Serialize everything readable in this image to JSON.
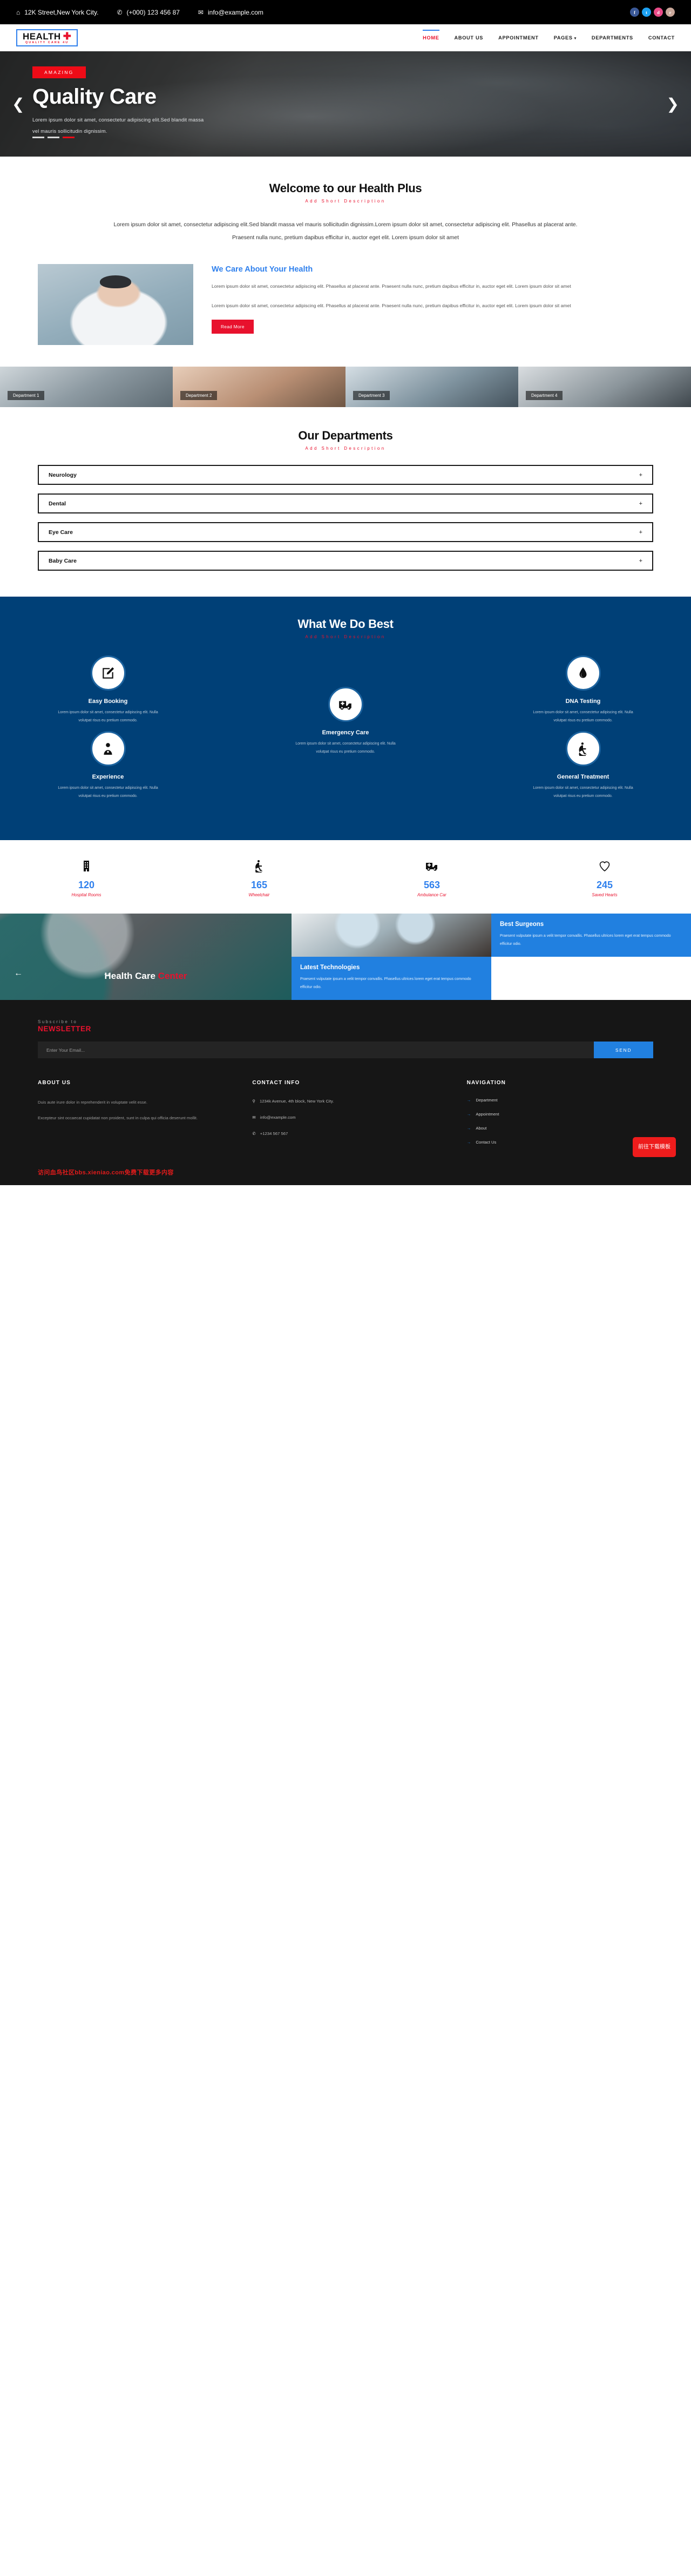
{
  "topbar": {
    "address": "12K Street,New York City.",
    "phone": "(+000) 123 456 87",
    "email": "info@example.com",
    "social": [
      "f",
      "t",
      "d",
      "r"
    ]
  },
  "logo": {
    "line1": "HEALTH",
    "cross": "✚",
    "line2": "QUALITY CARE 4U"
  },
  "nav": {
    "items": [
      {
        "label": "HOME",
        "active": true
      },
      {
        "label": "ABOUT US",
        "active": false
      },
      {
        "label": "APPOINTMENT",
        "active": false
      },
      {
        "label": "PAGES",
        "active": false,
        "caret": "▾"
      },
      {
        "label": "DEPARTMENTS",
        "active": false
      },
      {
        "label": "CONTACT",
        "active": false
      }
    ]
  },
  "hero": {
    "badge": "AMAZING",
    "title": "Quality Care",
    "text": "Lorem ipsum dolor sit amet, consectetur adipiscing elit.Sed blandit massa vel mauris sollicitudin dignissim.",
    "prev": "❮",
    "next": "❯"
  },
  "welcome": {
    "title": "Welcome to our Health Plus",
    "subtitle": "Add Short Description",
    "body": "Lorem ipsum dolor sit amet, consectetur adipiscing elit.Sed blandit massa vel mauris sollicitudin dignissim.Lorem ipsum dolor sit amet, consectetur adipiscing elit. Phasellus at placerat ante. Praesent nulla nunc, pretium dapibus efficitur in, auctor eget elit. Lorem ipsum dolor sit amet"
  },
  "care": {
    "heading": "We Care About Your Health",
    "p1": "Lorem ipsum dolor sit amet, consectetur adipiscing elit. Phasellus at placerat ante. Praesent nulla nunc, pretium dapibus efficitur in, auctor eget elit. Lorem ipsum dolor sit amet",
    "p2": "Lorem ipsum dolor sit amet, consectetur adipiscing elit. Phasellus at placerat ante. Praesent nulla nunc, pretium dapibus efficitur in, auctor eget elit. Lorem ipsum dolor sit amet",
    "button": "Read More"
  },
  "dept_strip": [
    {
      "label": "Department 1"
    },
    {
      "label": "Department 2"
    },
    {
      "label": "Department 3"
    },
    {
      "label": "Department 4"
    }
  ],
  "departments": {
    "title": "Our Departments",
    "subtitle": "Add Short Description",
    "items": [
      {
        "name": "Neurology",
        "toggle": "+"
      },
      {
        "name": "Dental",
        "toggle": "+"
      },
      {
        "name": "Eye Care",
        "toggle": "+"
      },
      {
        "name": "Baby Care",
        "toggle": "+"
      }
    ]
  },
  "best": {
    "title": "What We Do Best",
    "subtitle": "Add Short Description",
    "desc": "Lorem ipsum dolor sit amet, consectetur adipiscing elit. Nulla volutpat risus eu pretium commodo.",
    "items": [
      {
        "title": "Easy Booking",
        "icon": "pencil-square-icon"
      },
      {
        "title": "Emergency Care",
        "icon": "ambulance-icon"
      },
      {
        "title": "DNA Testing",
        "icon": "blood-drop-icon"
      },
      {
        "title": "Experience",
        "icon": "doctor-icon"
      },
      {
        "title": "General Treatment",
        "icon": "wheelchair-icon"
      }
    ]
  },
  "counters": [
    {
      "value": "120",
      "label": "Hospital Rooms",
      "icon": "hospital-building-icon"
    },
    {
      "value": "165",
      "label": "Wheelchair",
      "icon": "wheelchair-icon"
    },
    {
      "value": "563",
      "label": "Ambulance Car",
      "icon": "ambulance-icon"
    },
    {
      "value": "245",
      "label": "Saved Hearts",
      "icon": "heart-icon"
    }
  ],
  "gallery": {
    "title_white": "Health Care ",
    "title_red": "Center",
    "prev": "←",
    "next": "→",
    "cards": [
      {
        "title": "Best Surgeons",
        "text": "Praesent vulputate ipsum a velit tempor convallis. Phasellus ultrices lorem eget erat tempus commodo efficitur odio."
      },
      {
        "title": "Latest Technologies",
        "text": "Praesent vulputate ipsum a velit tempor convallis. Phasellus ultrices lorem eget erat tempus commodo efficitur odio."
      }
    ]
  },
  "newsletter": {
    "small": "Subscribe to",
    "big": "NEWSLETTER",
    "placeholder": "Enter Your Email...",
    "button": "SEND"
  },
  "footer": {
    "about": {
      "heading": "ABOUT US",
      "p1": "Duis aute irure dolor in reprehenderit in voluptate velit esse.",
      "p2": "Excepteur sint occaecat cupidatat non proident, sunt in culpa qui officia deserunt mollit."
    },
    "contact": {
      "heading": "CONTACT INFO",
      "address": "1234k Avenue, 4th block, New York City.",
      "email": "info@example.com",
      "phone": "+1234 567 567"
    },
    "navigation": {
      "heading": "NAVIGATION",
      "items": [
        "Department",
        "Appointment",
        "About",
        "Contact Us"
      ]
    },
    "watermark": "访问血鸟社区bbs.xieniao.com免费下载更多内容",
    "download_button": "前往下载模板"
  },
  "colors": {
    "accent_blue": "#2f80ed",
    "accent_red": "#e8112d",
    "deep_blue": "#004077",
    "dark": "#161616"
  }
}
